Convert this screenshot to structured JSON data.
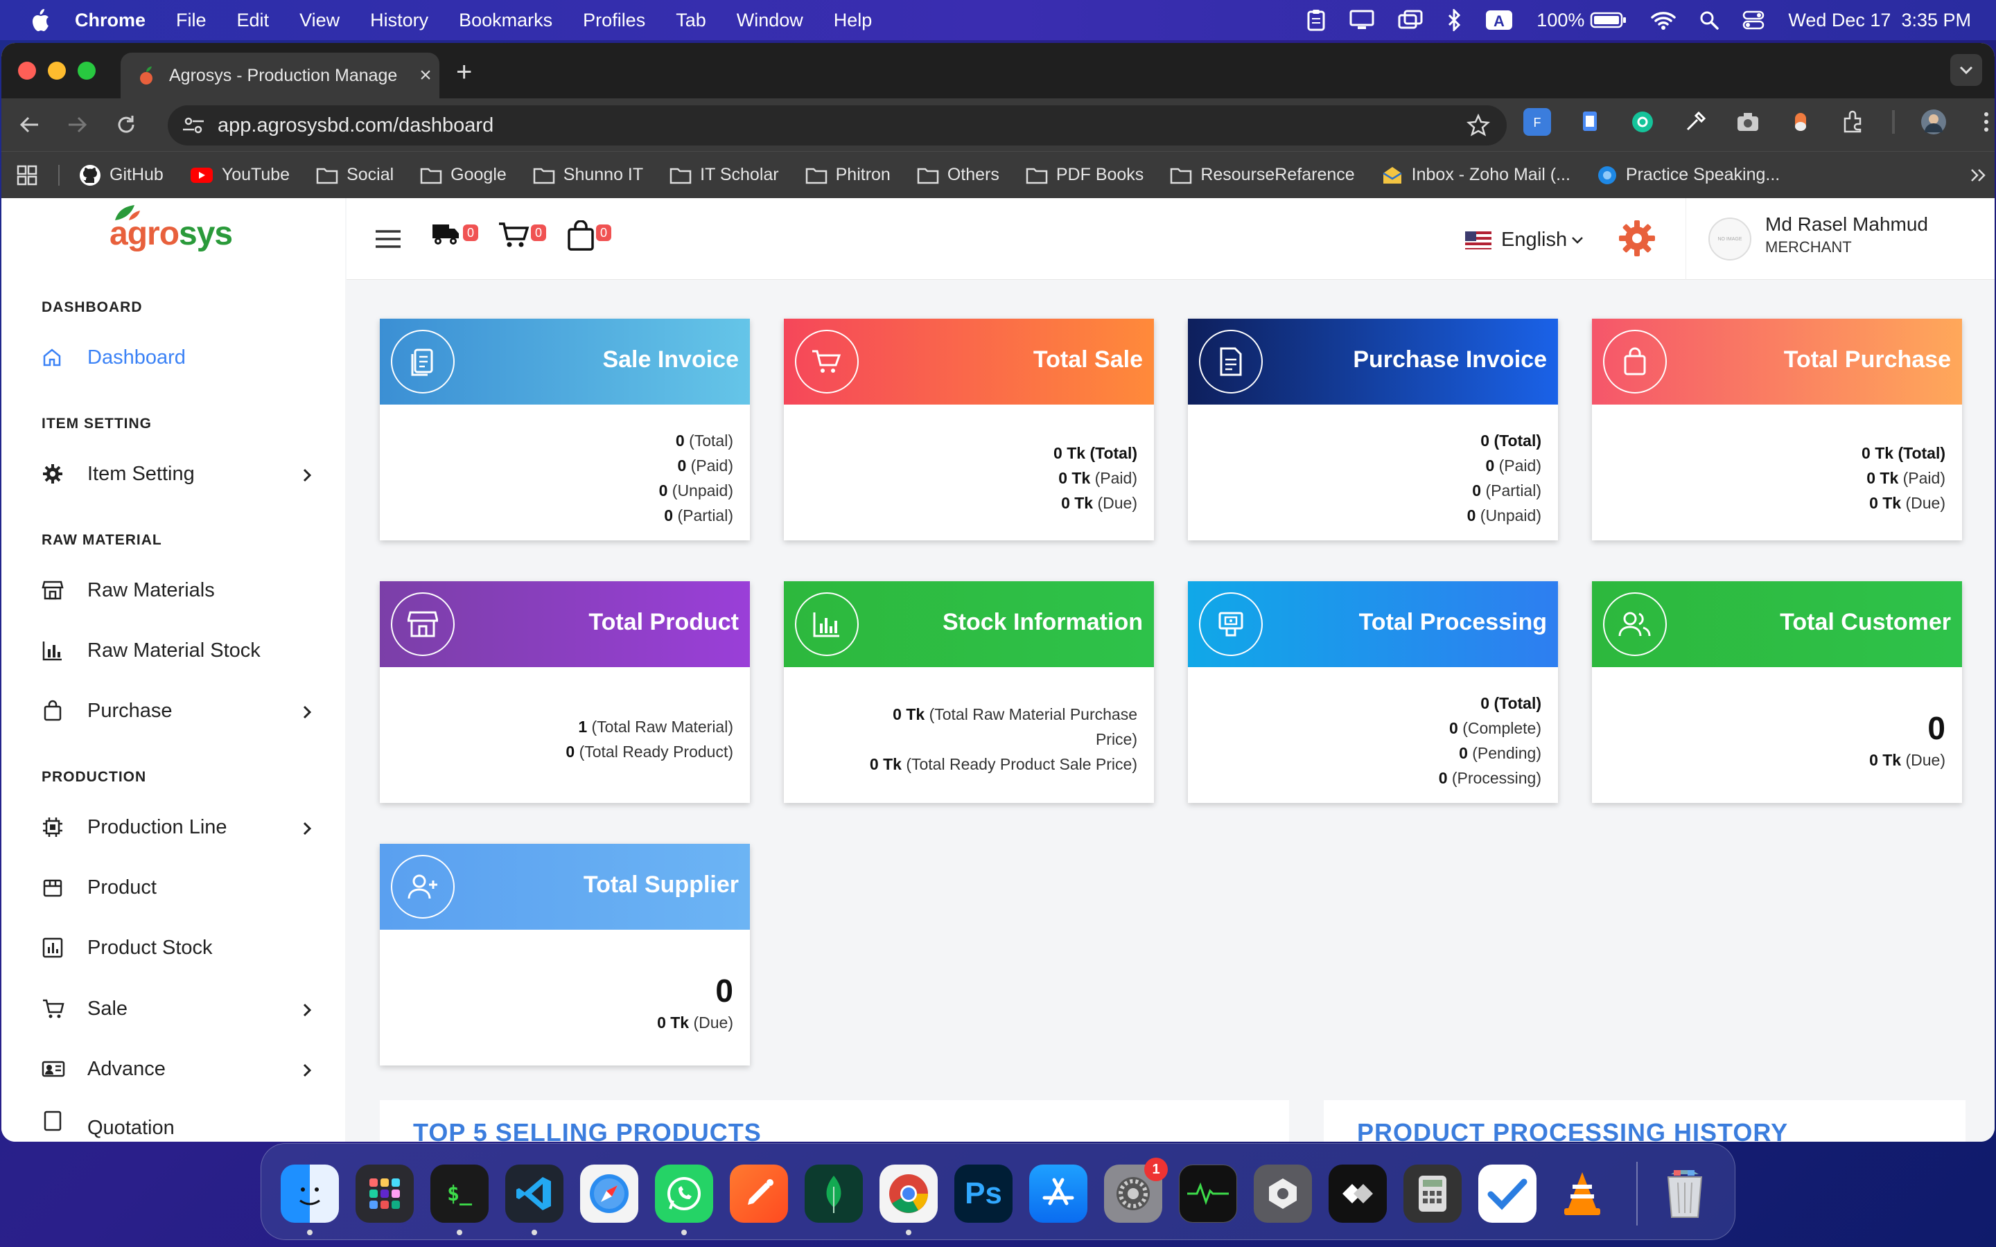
{
  "menubar": {
    "items": [
      "Chrome",
      "File",
      "Edit",
      "View",
      "History",
      "Bookmarks",
      "Profiles",
      "Tab",
      "Window",
      "Help"
    ],
    "battery": "100%",
    "datetime": "Wed Dec 17  3:35 PM"
  },
  "browser": {
    "tab_title": "Agrosys - Production Manage",
    "url": "app.agrosysbd.com/dashboard",
    "bookmarks": [
      "GitHub",
      "YouTube",
      "Social",
      "Google",
      "Shunno IT",
      "IT Scholar",
      "Phitron",
      "Others",
      "PDF Books",
      "ResourseRefarence",
      "Inbox - Zoho Mail (...",
      "Practice Speaking..."
    ]
  },
  "sidebar": {
    "logo_a": "agro",
    "logo_b": "sys",
    "sections": {
      "dashboard": "DASHBOARD",
      "item_setting": "ITEM SETTING",
      "raw_material": "RAW MATERIAL",
      "production": "PRODUCTION"
    },
    "items": {
      "dashboard": "Dashboard",
      "item_setting": "Item Setting",
      "raw_materials": "Raw Materials",
      "raw_material_stock": "Raw Material Stock",
      "purchase": "Purchase",
      "production_line": "Production Line",
      "product": "Product",
      "product_stock": "Product Stock",
      "sale": "Sale",
      "advance": "Advance",
      "quotation": "Quotation"
    }
  },
  "topbar": {
    "badges": {
      "delivery": "0",
      "cart": "0",
      "bag": "0"
    },
    "language": "English",
    "avatar_text": "NO IMAGE",
    "user_name": "Md Rasel Mahmud",
    "user_role": "MERCHANT"
  },
  "cards": {
    "sale_invoice": {
      "title": "Sale Invoice",
      "lines": [
        [
          "0",
          "(Total)"
        ],
        [
          "0",
          "(Paid)"
        ],
        [
          "0",
          "(Unpaid)"
        ],
        [
          "0",
          "(Partial)"
        ]
      ]
    },
    "total_sale": {
      "title": "Total Sale",
      "lines": [
        [
          "0 Tk",
          "(Total)"
        ],
        [
          "0 Tk",
          "(Paid)"
        ],
        [
          "0 Tk",
          "(Due)"
        ]
      ]
    },
    "purchase_invoice": {
      "title": "Purchase Invoice",
      "lines": [
        [
          "0",
          "(Total)"
        ],
        [
          "0",
          "(Paid)"
        ],
        [
          "0",
          "(Partial)"
        ],
        [
          "0",
          "(Unpaid)"
        ]
      ]
    },
    "total_purchase": {
      "title": "Total Purchase",
      "lines": [
        [
          "0 Tk",
          "(Total)"
        ],
        [
          "0 Tk",
          "(Paid)"
        ],
        [
          "0 Tk",
          "(Due)"
        ]
      ]
    },
    "total_product": {
      "title": "Total Product",
      "lines": [
        [
          "1",
          "(Total Raw Material)"
        ],
        [
          "0",
          "(Total Ready Product)"
        ]
      ]
    },
    "stock_information": {
      "title": "Stock Information",
      "line1_value": "0 Tk",
      "line1_label": "(Total Raw Material Purchase",
      "line1_cont": "Price)",
      "line2_value": "0 Tk",
      "line2_label": "(Total Ready Product Sale Price)"
    },
    "total_processing": {
      "title": "Total Processing",
      "lines": [
        [
          "0",
          "(Total)"
        ],
        [
          "0",
          "(Complete)"
        ],
        [
          "0",
          "(Pending)"
        ],
        [
          "0",
          "(Processing)"
        ]
      ]
    },
    "total_customer": {
      "title": "Total Customer",
      "big": "0",
      "due_value": "0 Tk",
      "due_label": "(Due)"
    },
    "total_supplier": {
      "title": "Total Supplier",
      "big": "0",
      "due_value": "0 Tk",
      "due_label": "(Due)"
    }
  },
  "panels": {
    "top_selling": "TOP 5 SELLING PRODUCTS",
    "processing_history": "PRODUCT PROCESSING HISTORY"
  },
  "dock": {
    "settings_badge": "1",
    "terminal_label": "$_",
    "photoshop_label": "Ps"
  }
}
